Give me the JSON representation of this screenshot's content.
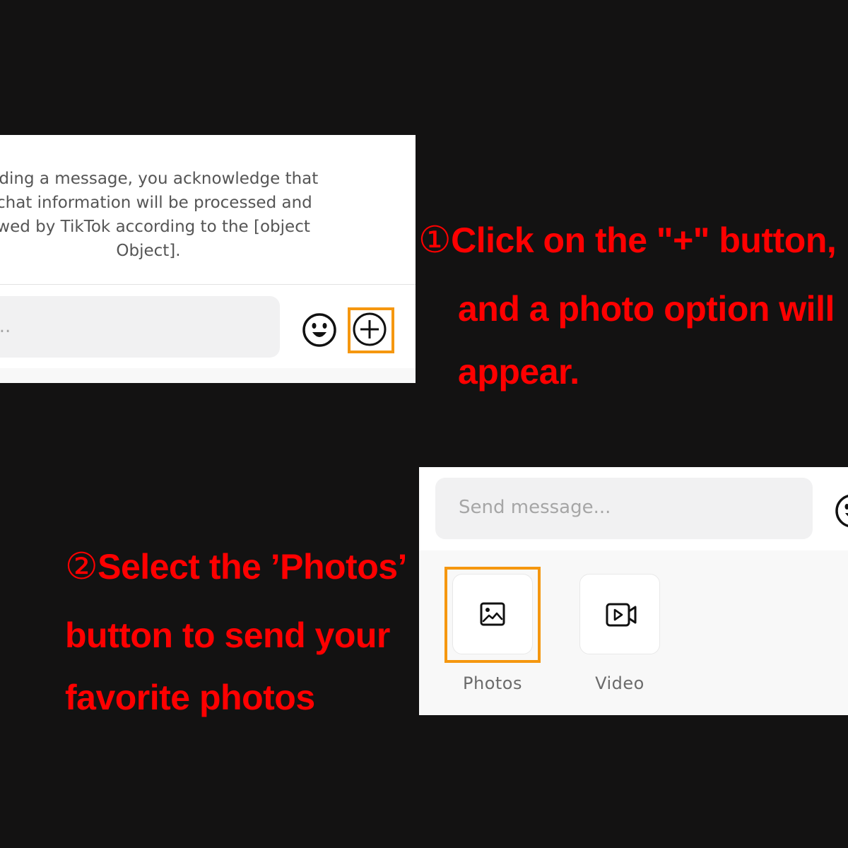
{
  "panel1": {
    "notice_text": "ending a message, you acknowledge that\nr chat information will be processed and\newed by TikTok according to the [object\nObject].",
    "input_placeholder": "essage...",
    "emoji_icon": "smiley-icon",
    "plus_icon": "plus-circle-icon"
  },
  "step1": {
    "number": "①",
    "line1": "Click on the \"+\" button,",
    "line2": "and a photo option will",
    "line3": "appear."
  },
  "step2": {
    "number": "②",
    "line1": "Select the ’Photos’",
    "line2": "button to send your",
    "line3": "favorite photos"
  },
  "panel2": {
    "input_placeholder": "Send message...",
    "emoji_icon": "smiley-icon",
    "options": [
      {
        "label": "Photos",
        "icon": "image-icon"
      },
      {
        "label": "Video",
        "icon": "video-camera-icon"
      }
    ]
  },
  "colors": {
    "background": "#131212",
    "caption": "#ff0000",
    "highlight": "#f5970f",
    "input_bg": "#f1f1f2",
    "placeholder": "#a6a6a6"
  }
}
